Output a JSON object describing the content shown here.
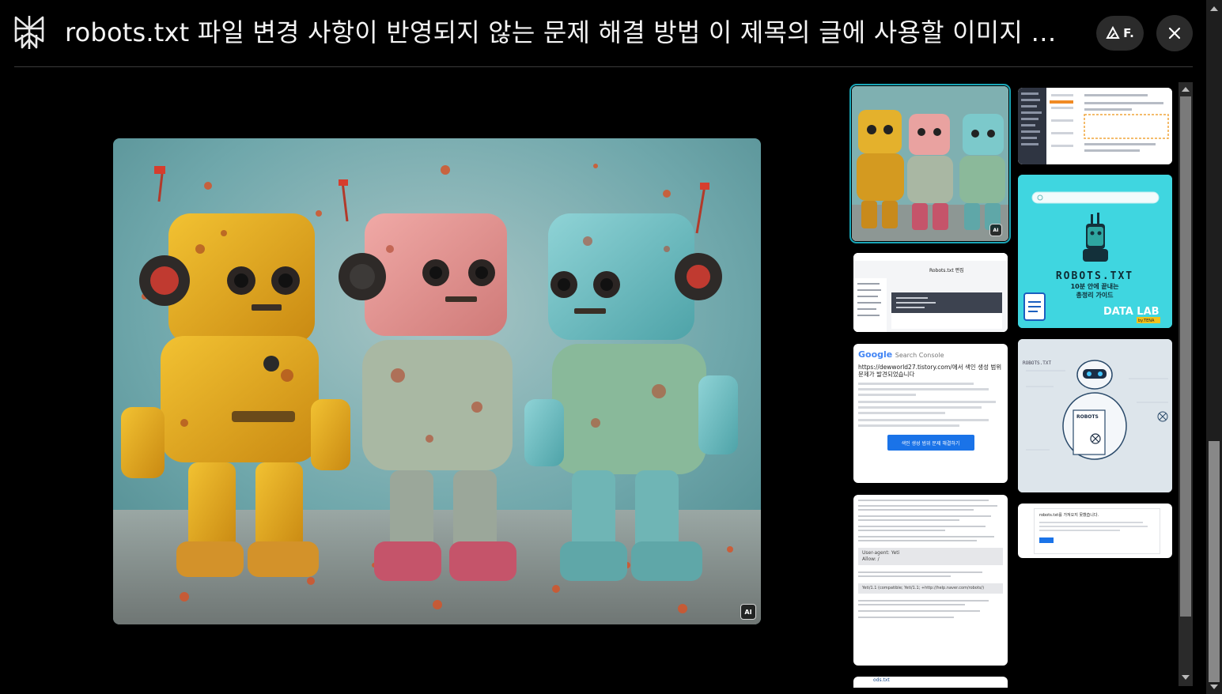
{
  "header": {
    "title": "robots.txt 파일 변경 사항이 반영되지 않는 문제 해결 방법 이 제목의 글에 사용할 이미지 만들어줘",
    "pill_label": "F.",
    "close_icon": "close-icon",
    "logo_icon": "perplexity-logo-icon"
  },
  "main_image": {
    "subject": "Three rusty toy robots (yellow, pink, teal)",
    "badge": "AI"
  },
  "thumbnails": [
    {
      "id": "t1",
      "kind": "robots-photo",
      "badge": "AI",
      "selected": true
    },
    {
      "id": "t2",
      "kind": "search-console-settings"
    },
    {
      "id": "t3",
      "kind": "robots-edit-dialog",
      "title": "Robots.txt 편집"
    },
    {
      "id": "t4",
      "kind": "robots-guide-card",
      "title": "ROBOTS.TXT",
      "subtitle": "10분 안에 끝내는",
      "subtitle2": "총정리 가이드",
      "brand": "DATA LAB",
      "brand_sub": "by.TENA"
    },
    {
      "id": "t5",
      "kind": "search-console-email",
      "brand": "Google",
      "product": "Search Console",
      "heading": "https://dewworld27.tistory.com/에서 색인 생성 범위 문제가 발견되었습니다",
      "button": "색인 생성 범위 문제 해결하기"
    },
    {
      "id": "t6",
      "kind": "robot-illustration",
      "label": "ROBOTS.TXT",
      "doc_label": "ROBOTS"
    },
    {
      "id": "t7",
      "kind": "article-text",
      "code1": "User-agent: Yeti",
      "code2": "Allow: /",
      "code3": "Yeti/1.1 (compatible; Yeti/1.1; +http://help.naver.com/robots/)"
    },
    {
      "id": "t8",
      "kind": "robots-popup",
      "title": "robots.txt를 가져오지 못했습니다."
    },
    {
      "id": "t9",
      "kind": "partial",
      "label": "ods.txt"
    }
  ],
  "colors": {
    "accent": "#1aa6b7",
    "button_blue": "#1a73e8",
    "guide_bg": "#3fd6e0"
  }
}
